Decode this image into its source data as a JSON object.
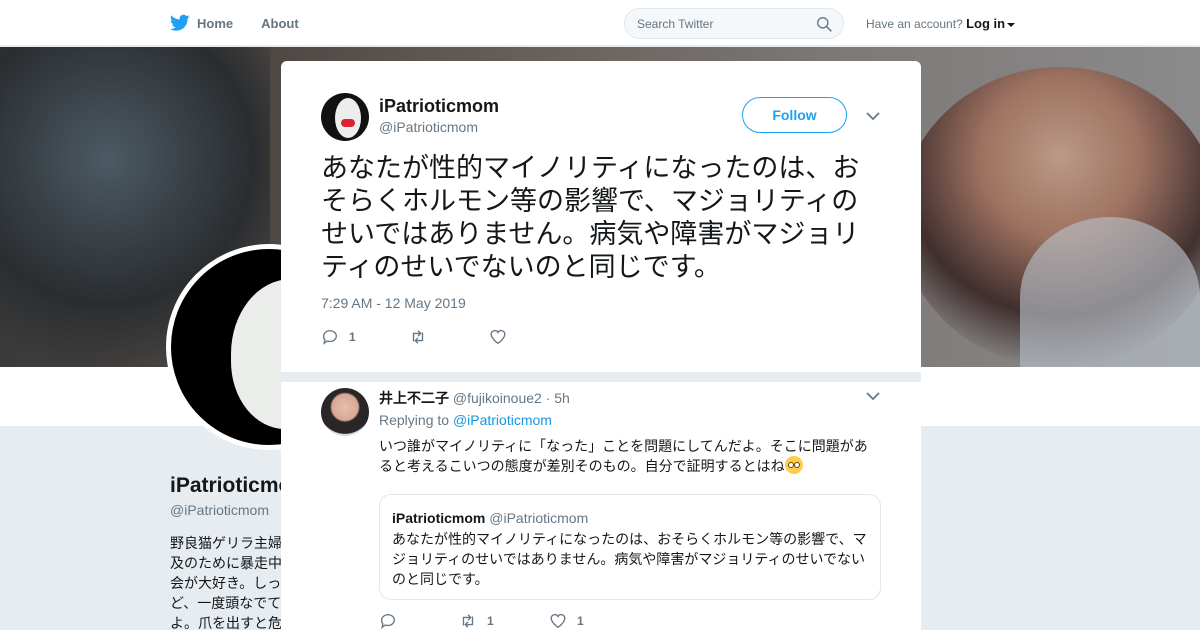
{
  "nav": {
    "home": "Home",
    "about": "About",
    "search_placeholder": "Search Twitter",
    "have_account": "Have an account?",
    "login": "Log in"
  },
  "profile": {
    "name": "iPatrioticmom",
    "handle": "@iPatrioticmom",
    "bio": "野良猫ゲリラ主婦…及のために暴走中…会が大好き。しっ…ど、一度頭なでて…よ。爪を出すと危…"
  },
  "tweet": {
    "name": "iPatrioticmom",
    "handle": "@iPatrioticmom",
    "follow_label": "Follow",
    "text": "あなたが性的マイノリティになったのは、おそらくホルモン等の影響で、マジョリティのせいではありません。病気や障害がマジョリティのせいでないのと同じです。",
    "timestamp": "7:29 AM - 12 May 2019",
    "reply_count": "1",
    "retweet_count": "",
    "like_count": ""
  },
  "reply": {
    "name": "井上不二子",
    "handle": "@fujikoinoue2",
    "time": "· 5h",
    "replying_prefix": "Replying to",
    "replying_to": "@iPatrioticmom",
    "text": "いつ誰がマイノリティに「なった」ことを問題にしてんだよ。そこに問題があると考えるこいつの態度が差別そのもの。自分で証明するとはね",
    "emoji": "face-with-rolling-eyes",
    "reply_count": "",
    "retweet_count": "1",
    "like_count": "1",
    "quote": {
      "name": "iPatrioticmom",
      "handle": "@iPatrioticmom",
      "text": "あなたが性的マイノリティになったのは、おそらくホルモン等の影響で、マジョリティのせいではありません。病気や障害がマジョリティのせいでないのと同じです。"
    }
  },
  "colors": {
    "accent": "#1da1f2",
    "link": "#1b95e0",
    "secondary_text": "#657786"
  }
}
